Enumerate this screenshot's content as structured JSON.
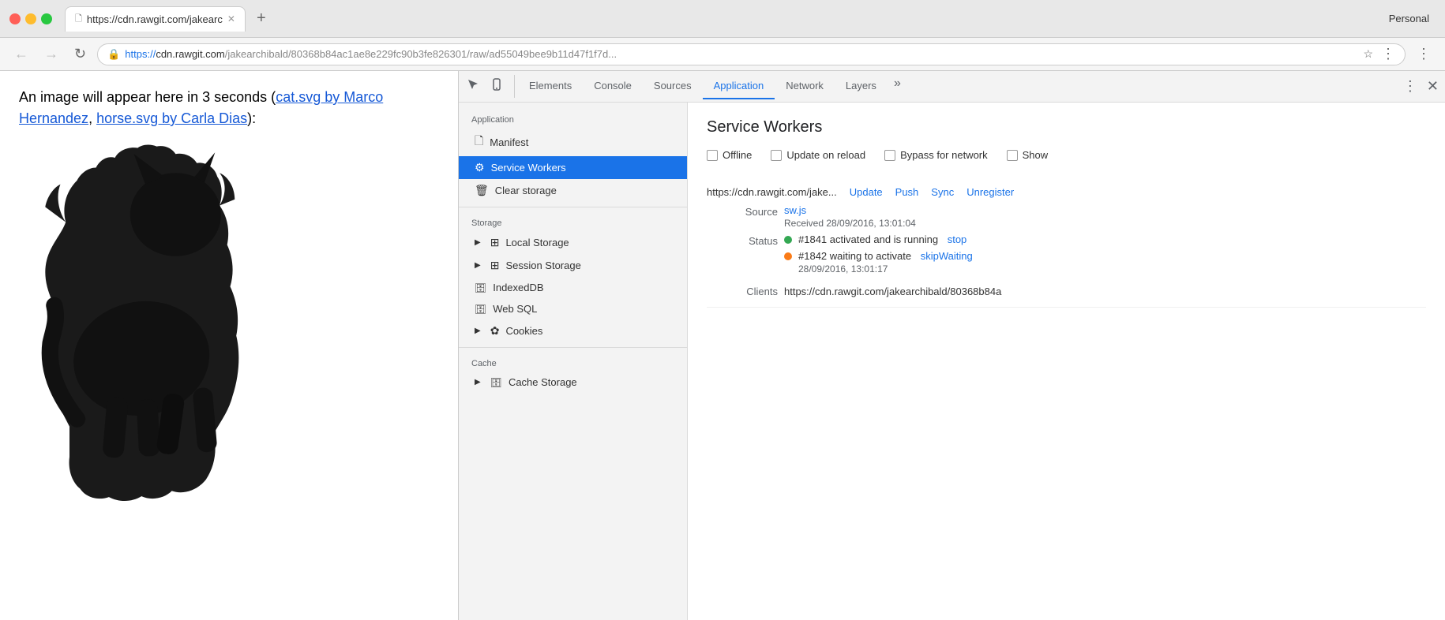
{
  "browser": {
    "profile_label": "Personal",
    "tab_url": "https://cdn.rawgit.com/jakearc",
    "tab_favicon": "🗋",
    "full_url": "https://cdn.rawgit.com/jakearchibald/80368b84ac1ae8e229fc90b3fe826301/raw/ad55049bee9b11d47f1f7d...",
    "url_display_scheme": "https://",
    "url_display_host": "cdn.rawgit.com",
    "url_display_path": "/jakearchibald/80368b84ac1ae8e229fc90b3fe826301/raw/ad55049bee9b11d47f1f7d...",
    "nav_back": "←",
    "nav_forward": "→",
    "nav_reload": "↻"
  },
  "page": {
    "text_before": "An image will appear here in 3 seconds (",
    "link1_text": "cat.svg by Marco Hernandez",
    "link_separator": ", ",
    "link2_text": "horse.svg by Carla Dias",
    "text_after": "):"
  },
  "devtools": {
    "toolbar_icons": [
      "cursor-icon",
      "mobile-icon"
    ],
    "tabs": [
      {
        "id": "elements",
        "label": "Elements"
      },
      {
        "id": "console",
        "label": "Console"
      },
      {
        "id": "sources",
        "label": "Sources"
      },
      {
        "id": "application",
        "label": "Application"
      },
      {
        "id": "network",
        "label": "Network"
      },
      {
        "id": "layers",
        "label": "Layers"
      }
    ],
    "active_tab": "application",
    "more_label": "»",
    "close_icon": "✕",
    "menu_icon": "⋮",
    "sidebar": {
      "application_section": "Application",
      "manifest_label": "Manifest",
      "service_workers_label": "Service Workers",
      "clear_storage_label": "Clear storage",
      "storage_section": "Storage",
      "local_storage_label": "Local Storage",
      "session_storage_label": "Session Storage",
      "indexeddb_label": "IndexedDB",
      "web_sql_label": "Web SQL",
      "cookies_label": "Cookies",
      "cache_section": "Cache",
      "cache_storage_label": "Cache Storage"
    },
    "panel": {
      "title": "Service Workers",
      "options": [
        {
          "id": "offline",
          "label": "Offline"
        },
        {
          "id": "update_on_reload",
          "label": "Update on reload"
        },
        {
          "id": "bypass_for_network",
          "label": "Bypass for network"
        },
        {
          "id": "show",
          "label": "Show"
        }
      ],
      "sw_url": "https://cdn.rawgit.com/jake...",
      "sw_actions": [
        "Update",
        "Push",
        "Sync",
        "Unregister"
      ],
      "source_label": "Source",
      "source_file": "sw.js",
      "received_label": "Received 28/09/2016, 13:01:04",
      "status_label": "Status",
      "status1_text": "#1841 activated and is running",
      "status1_action": "stop",
      "status1_dot": "green",
      "status2_text": "#1842 waiting to activate",
      "status2_action": "skipWaiting",
      "status2_dot": "orange",
      "status2_timestamp": "28/09/2016, 13:01:17",
      "clients_label": "Clients",
      "clients_value": "https://cdn.rawgit.com/jakearchibald/80368b84a"
    }
  }
}
